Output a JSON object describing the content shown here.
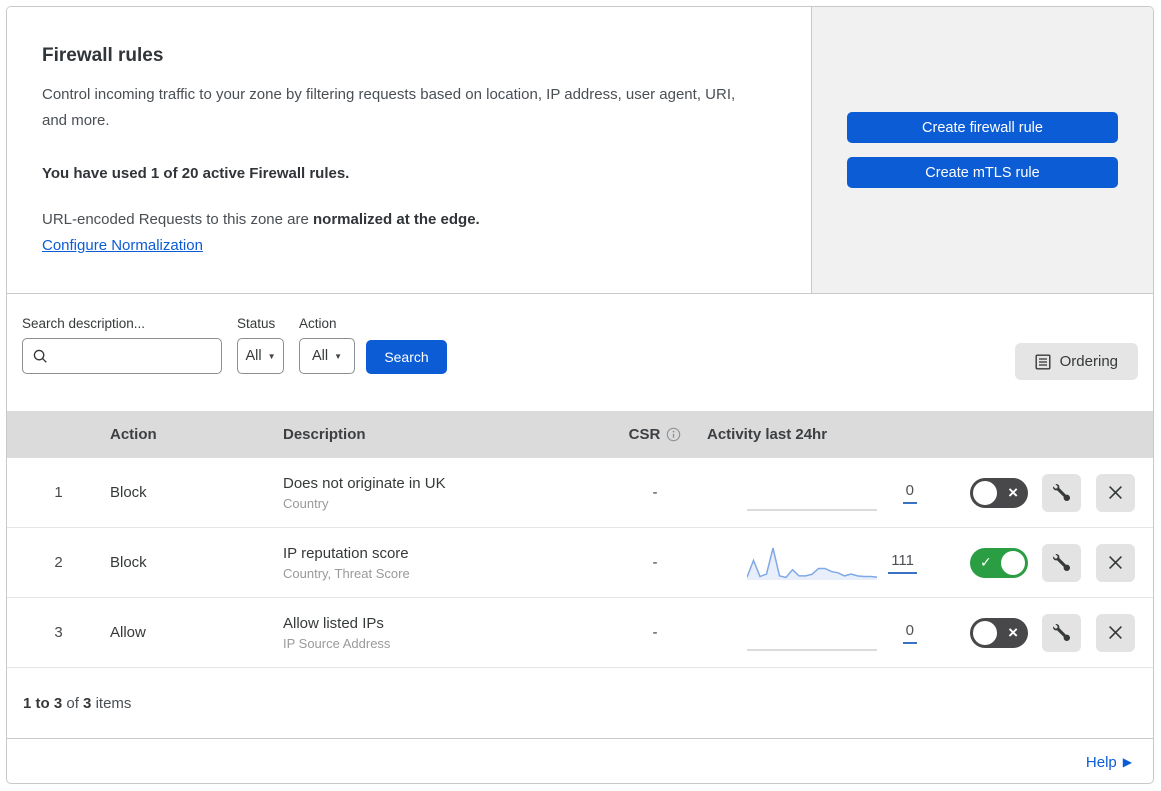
{
  "header": {
    "title": "Firewall rules",
    "description": "Control incoming traffic to your zone by filtering requests based on location, IP address, user agent, URI, and more.",
    "usage_note": "You have used 1 of 20 active Firewall rules.",
    "normalization_prefix": "URL-encoded Requests to this zone are ",
    "normalization_bold": "normalized at the edge.",
    "normalization_link": "Configure Normalization"
  },
  "actions": {
    "create_firewall_rule": "Create firewall rule",
    "create_mtls_rule": "Create mTLS rule"
  },
  "filters": {
    "search_label": "Search description...",
    "search_placeholder": "",
    "search_value": "",
    "status_label": "Status",
    "status_value": "All",
    "action_label": "Action",
    "action_value": "All",
    "search_button": "Search",
    "ordering_button": "Ordering"
  },
  "table": {
    "columns": {
      "action": "Action",
      "description": "Description",
      "csr": "CSR",
      "activity": "Activity last 24hr"
    },
    "rows": [
      {
        "priority": "1",
        "action": "Block",
        "description": "Does not originate in UK",
        "criteria": "Country",
        "csr": "-",
        "activity_count": "0",
        "enabled": false,
        "sparkline": []
      },
      {
        "priority": "2",
        "action": "Block",
        "description": "IP reputation score",
        "criteria": "Country, Threat Score",
        "csr": "-",
        "activity_count": "111",
        "enabled": true,
        "sparkline": [
          0.06,
          0.6,
          0.08,
          0.16,
          1.0,
          0.1,
          0.05,
          0.3,
          0.1,
          0.1,
          0.15,
          0.34,
          0.34,
          0.24,
          0.2,
          0.1,
          0.16,
          0.1,
          0.08,
          0.08,
          0.06
        ]
      },
      {
        "priority": "3",
        "action": "Allow",
        "description": "Allow listed IPs",
        "criteria": "IP Source Address",
        "csr": "-",
        "activity_count": "0",
        "enabled": false,
        "sparkline": []
      }
    ],
    "summary": {
      "range": "1 to 3",
      "of_word": "of",
      "total": "3",
      "items_word": "items"
    }
  },
  "footer": {
    "help": "Help"
  },
  "colors": {
    "accent_blue": "#0b5cd5",
    "toggle_on_green": "#2b9e44",
    "toggle_off_gray": "#48484a",
    "sparkline_blue": "#7fa8e6",
    "table_header_gray": "#dbdbdb",
    "panel_gray": "#f1f1f1"
  }
}
